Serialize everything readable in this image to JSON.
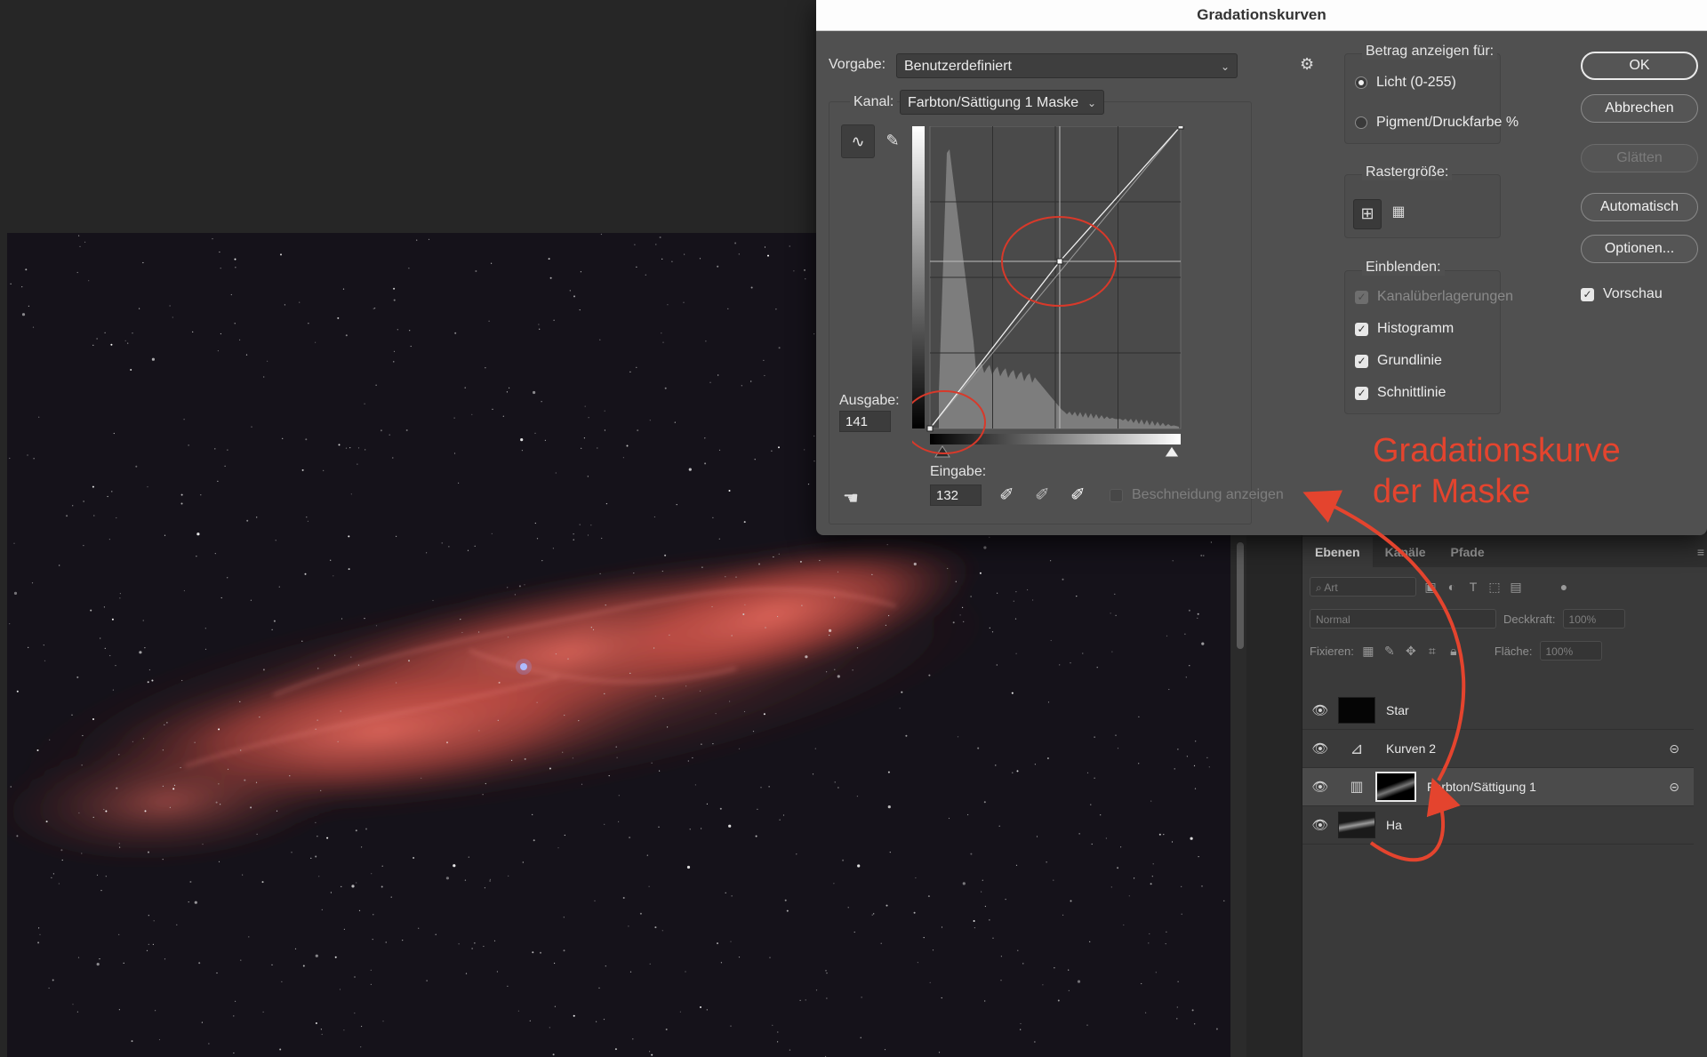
{
  "dialog": {
    "title": "Gradationskurven",
    "preset_label": "Vorgabe:",
    "preset_value": "Benutzerdefiniert",
    "channel_label": "Kanal:",
    "channel_value": "Farbton/Sättigung 1 Maske",
    "output_label": "Ausgabe:",
    "output_value": "141",
    "input_label": "Eingabe:",
    "input_value": "132",
    "show_clipping_label": "Beschneidung anzeigen",
    "amount_group": {
      "title": "Betrag anzeigen für:",
      "options": [
        "Licht (0-255)",
        "Pigment/Druckfarbe %"
      ],
      "selected": "Licht (0-255)"
    },
    "grid_group": {
      "title": "Rastergröße:"
    },
    "show_group": {
      "title": "Einblenden:",
      "options": [
        {
          "label": "Kanalüberlagerungen",
          "checked": true,
          "enabled": false
        },
        {
          "label": "Histogramm",
          "checked": true,
          "enabled": true
        },
        {
          "label": "Grundlinie",
          "checked": true,
          "enabled": true
        },
        {
          "label": "Schnittlinie",
          "checked": true,
          "enabled": true
        }
      ]
    },
    "buttons": {
      "ok": "OK",
      "cancel": "Abbrechen",
      "smooth": "Glätten",
      "auto": "Automatisch",
      "options": "Optionen..."
    },
    "preview_label": "Vorschau",
    "preview_checked": true,
    "curve_points": [
      {
        "input": 0,
        "output": 0
      },
      {
        "input": 132,
        "output": 141
      },
      {
        "input": 255,
        "output": 255
      }
    ]
  },
  "layers_panel": {
    "tabs": [
      "Ebenen",
      "Kanäle",
      "Pfade"
    ],
    "active_tab": "Ebenen",
    "filter_placeholder": "Art",
    "blend_mode": "Normal",
    "opacity_label": "Deckkraft:",
    "opacity_value": "100%",
    "lock_label": "Fixieren:",
    "fill_label": "Fläche:",
    "fill_value": "100%",
    "layers": [
      {
        "name": "Star",
        "selected": false
      },
      {
        "name": "Kurven 2",
        "selected": false
      },
      {
        "name": "Farbton/Sättigung 1",
        "selected": true
      },
      {
        "name": "Ha",
        "selected": false
      }
    ]
  },
  "annotation": {
    "line1": "Gradationskurve",
    "line2": "der Maske",
    "color": "#e4442e"
  },
  "colors": {
    "nebula": "#d0584f",
    "accent_red": "#e4442e"
  },
  "icons": [
    "gear-icon",
    "curve-tool-icon",
    "pencil-icon",
    "hand-adjust-icon",
    "eyedropper-black-icon",
    "eyedropper-gray-icon",
    "eyedropper-white-icon",
    "eye-icon",
    "link-icon",
    "panel-menu-icon"
  ]
}
